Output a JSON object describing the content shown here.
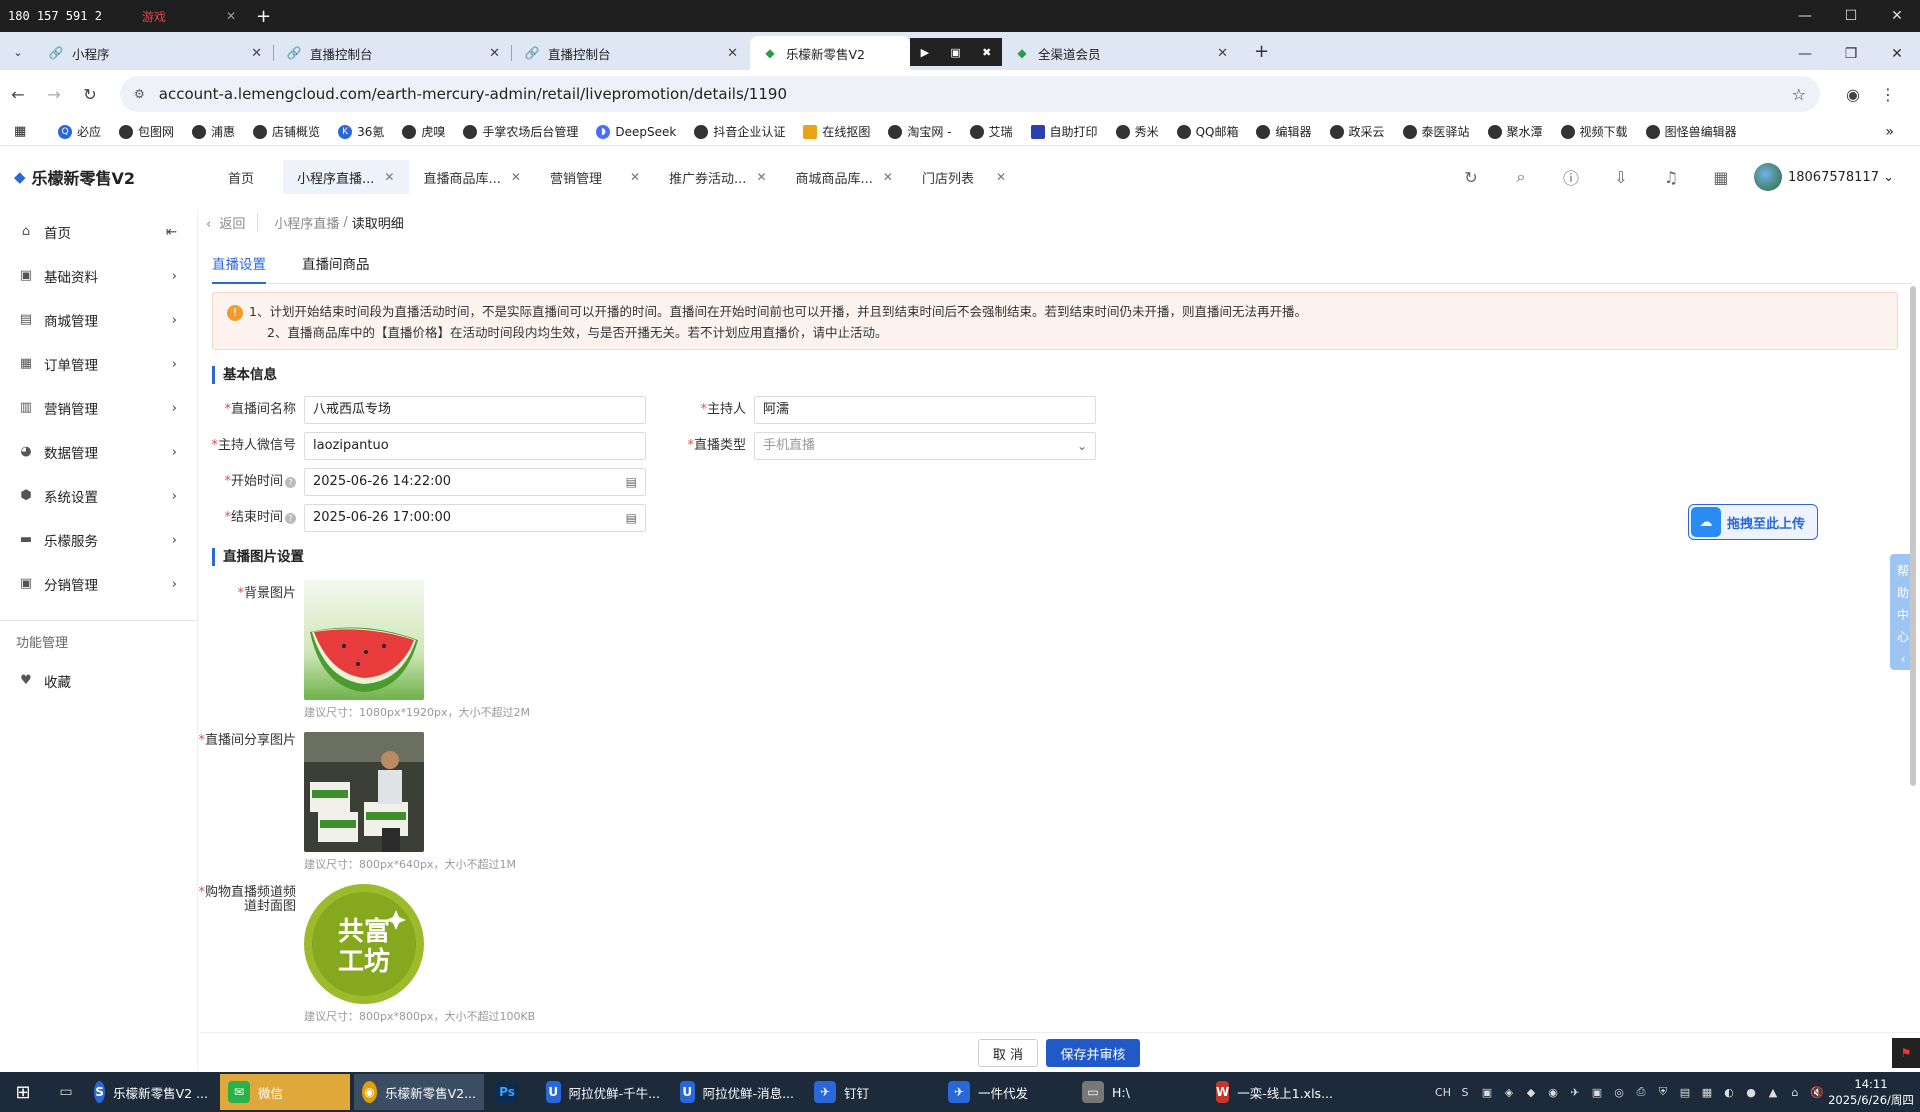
{
  "os": {
    "phone": "180 157 591 2",
    "red_tab": "游戏"
  },
  "browser": {
    "tabs": [
      {
        "label": "小程序"
      },
      {
        "label": "直播控制台"
      },
      {
        "label": "直播控制台"
      },
      {
        "label": "乐檬新零售V2",
        "active": true
      },
      {
        "label": "全渠道会员"
      }
    ],
    "url": "account-a.lemengcloud.com/earth-mercury-admin/retail/livepromotion/details/1190",
    "bookmarks": [
      "必应",
      "包图网",
      "浦惠",
      "店铺概览",
      "36氪",
      "虎嗅",
      "手掌农场后台管理",
      "DeepSeek",
      "抖音企业认证",
      "在线抠图",
      "淘宝网 -",
      "艾瑞",
      "自助打印",
      "秀米",
      "QQ邮箱",
      "编辑器",
      "政采云",
      "泰医驿站",
      "聚水潭",
      "视频下载",
      "图怪兽编辑器"
    ]
  },
  "app": {
    "logo": "乐檬新零售V2",
    "tabs": [
      "首页",
      "小程序直播...",
      "直播商品库...",
      "营销管理",
      "推广券活动...",
      "商城商品库...",
      "门店列表"
    ],
    "user": "18067578117"
  },
  "sidebar": {
    "items": [
      {
        "label": "首页",
        "icon": "home-icon"
      },
      {
        "label": "基础资料",
        "icon": "cube-icon"
      },
      {
        "label": "商城管理",
        "icon": "mall-icon"
      },
      {
        "label": "订单管理",
        "icon": "order-icon"
      },
      {
        "label": "营销管理",
        "icon": "chart-icon"
      },
      {
        "label": "数据管理",
        "icon": "pie-icon"
      },
      {
        "label": "系统设置",
        "icon": "gear-icon"
      },
      {
        "label": "乐檬服务",
        "icon": "truck-icon"
      },
      {
        "label": "分销管理",
        "icon": "share-icon"
      }
    ],
    "group_title": "功能管理",
    "favorites": "收藏"
  },
  "breadcrumb": {
    "back": "返回",
    "parent": "小程序直播",
    "sep": "/",
    "current": "读取明细"
  },
  "page_tabs": [
    "直播设置",
    "直播间商品"
  ],
  "notice": {
    "line1": "1、计划开始结束时间段为直播活动时间，不是实际直播间可以开播的时间。直播间在开始时间前也可以开播，并且到结束时间后不会强制结束。若到结束时间仍未开播，则直播间无法再开播。",
    "line2": "2、直播商品库中的【直播价格】在活动时间段内均生效，与是否开播无关。若不计划应用直播价，请中止活动。"
  },
  "basic_info": {
    "title": "基本信息",
    "room_name_label": "直播间名称",
    "room_name": "八戒西瓜专场",
    "host_label": "主持人",
    "host": "阿濡",
    "host_wechat_label": "主持人微信号",
    "host_wechat": "laozipantuo",
    "live_type_label": "直播类型",
    "live_type_placeholder": "手机直播",
    "start_label": "开始时间",
    "start": "2025-06-26 14:22:00",
    "end_label": "结束时间",
    "end": "2025-06-26 17:00:00"
  },
  "images": {
    "title": "直播图片设置",
    "bg_label": "背景图片",
    "bg_hint": "建议尺寸：1080px*1920px，大小不超过2M",
    "share_label": "直播间分享图片",
    "share_hint": "建议尺寸：800px*640px，大小不超过1M",
    "cover_label": "购物直播频道频道封面图",
    "cover_hint": "建议尺寸：800px*800px，大小不超过100KB",
    "cover_logo_text": "共富工坊"
  },
  "upload_button": "拖拽至此上传",
  "help_tab": [
    "帮",
    "助",
    "中",
    "心"
  ],
  "footer": {
    "cancel": "取 消",
    "save": "保存并审核"
  },
  "taskbar": {
    "items": [
      "乐檬新零售V2 ...",
      "微信",
      "乐檬新零售V2...",
      "阿拉优鲜-千牛...",
      "阿拉优鲜-消息...",
      "钉钉",
      "一件代发",
      "H:\\",
      "一栾-线上1.xls..."
    ],
    "lang": "CH",
    "time": "14:11",
    "date": "2025/6/26/周四"
  }
}
